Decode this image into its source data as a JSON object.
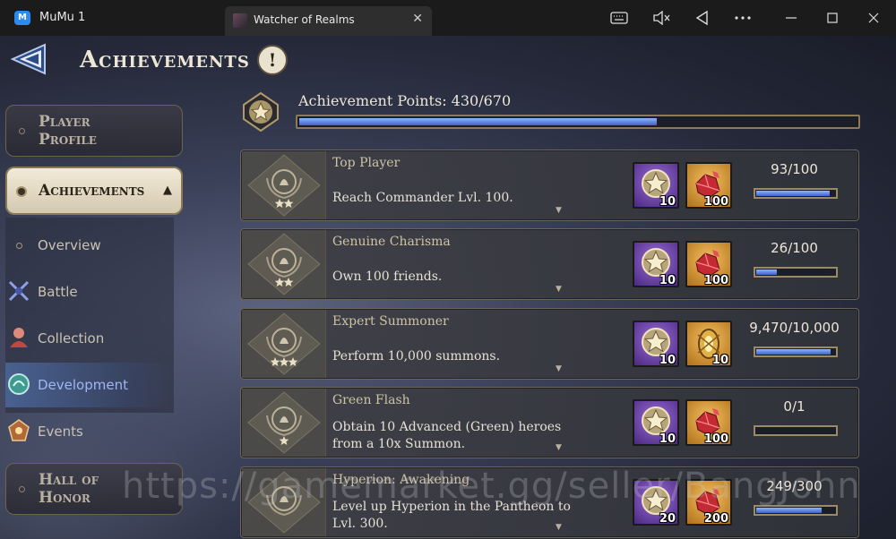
{
  "window": {
    "app_name": "MuMu 1",
    "app_logo_text": "M",
    "tab_title": "Watcher of Realms",
    "controls": [
      "keyboard-icon",
      "mute-icon",
      "back-icon",
      "more-icon",
      "minimize-icon",
      "maximize-icon",
      "close-icon"
    ]
  },
  "header": {
    "title": "Achievements",
    "info_glyph": "!"
  },
  "sidebar": {
    "player_profile": "Player Profile",
    "achievements": "Achievements",
    "sub_items": [
      {
        "label": "Overview",
        "icon": "dot"
      },
      {
        "label": "Battle",
        "icon": "crossed-swords-icon"
      },
      {
        "label": "Collection",
        "icon": "collection-icon"
      },
      {
        "label": "Development",
        "icon": "development-icon"
      },
      {
        "label": "Events",
        "icon": "events-icon"
      }
    ],
    "active_sub_item": "Development",
    "hall_of_honor": "Hall of Honor"
  },
  "points": {
    "label": "Achievement Points:",
    "value": "430/670",
    "progress": 0.642
  },
  "achievements": [
    {
      "title": "Top Player",
      "description": "Reach Commander Lvl. 100.",
      "stars": 2,
      "reward1": "10",
      "reward2": "100",
      "reward2_icon": "ruby-icon",
      "progress_text": "93/100",
      "progress": 0.93
    },
    {
      "title": "Genuine Charisma",
      "description": "Own 100 friends.",
      "stars": 2,
      "reward1": "10",
      "reward2": "100",
      "reward2_icon": "ruby-icon",
      "progress_text": "26/100",
      "progress": 0.26
    },
    {
      "title": "Expert Summoner",
      "description": "Perform 10,000 summons.",
      "stars": 3,
      "reward1": "10",
      "reward2": "10",
      "reward2_icon": "summon-crystal-icon",
      "progress_text": "9,470/10,000",
      "progress": 0.947
    },
    {
      "title": "Green Flash",
      "description": "Obtain 10 Advanced (Green) heroes from a 10x Summon.",
      "stars": 1,
      "reward1": "10",
      "reward2": "100",
      "reward2_icon": "ruby-icon",
      "progress_text": "0/1",
      "progress": 0
    },
    {
      "title": "Hyperion: Awakening",
      "description": "Level up Hyperion in the Pantheon to Lvl. 300.",
      "stars": 0,
      "reward1": "20",
      "reward2": "200",
      "reward2_icon": "ruby-icon",
      "progress_text": "249/300",
      "progress": 0.83
    }
  ],
  "watermark": "https://gamemarket.gg/seller/BangJohn",
  "colors": {
    "accent_blue": "#4a72d8",
    "gold_border": "#8a7a55",
    "title_text": "#cfc3a6"
  }
}
